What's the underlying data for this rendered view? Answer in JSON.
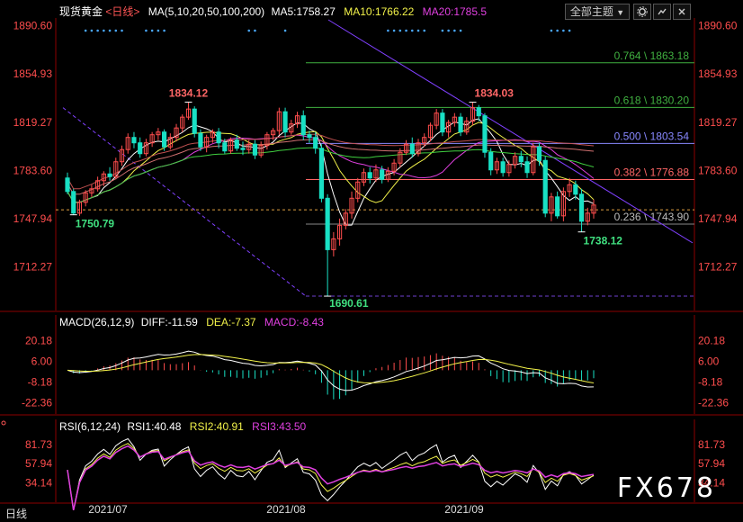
{
  "header": {
    "title": "现货黄金",
    "period": "<日线>",
    "ma_label": "MA(5,10,20,50,100,200)",
    "ma5": "MA5:1758.27",
    "ma10": "MA10:1766.22",
    "ma20": "MA20:1785.5",
    "menu_label": "全部主题",
    "menu_arrow": "▼"
  },
  "macd_header": {
    "label": "MACD(26,12,9)",
    "diff": "DIFF:-11.59",
    "dea": "DEA:-7.37",
    "macd": "MACD:-8.43"
  },
  "rsi_header": {
    "label": "RSI(6,12,24)",
    "rsi1": "RSI1:40.48",
    "rsi2": "RSI2:40.91",
    "rsi3": "RSI3:43.50"
  },
  "period_button": "日线",
  "watermark": "FX678",
  "colors": {
    "up": "#ff4d4d",
    "down": "#19e0c4",
    "ma5": "#ffffff",
    "ma10": "#f2f24a",
    "ma20": "#e040e0",
    "ma50": "#40d040",
    "ma100": "#d07070",
    "ma200": "#7070e0",
    "fib": "#40b040",
    "fib_half": "#8888ff",
    "fib_382": "#ff6666",
    "trend": "#8040ff"
  },
  "chart_data": {
    "type": "candlestick",
    "price_axis": {
      "ticks": [
        "1890.60",
        "1854.93",
        "1819.27",
        "1783.60",
        "1747.94",
        "1712.27"
      ],
      "range": [
        1680,
        1895
      ]
    },
    "macd_axis": {
      "ticks": [
        "20.18",
        "6.00",
        "-8.18",
        "-22.36"
      ]
    },
    "rsi_axis": {
      "ticks": [
        "81.73",
        "57.94",
        "34.14"
      ]
    },
    "dates": [
      "2021/07",
      "2021/08",
      "2021/09"
    ],
    "fibonacci": [
      {
        "label": "0.764 \\ 1863.18",
        "value": 1863.18
      },
      {
        "label": "0.618 \\ 1830.20",
        "value": 1830.2
      },
      {
        "label": "0.500 \\ 1803.54",
        "value": 1803.54
      },
      {
        "label": "0.382 \\ 1776.88",
        "value": 1776.88
      },
      {
        "label": "0.236 \\ 1743.90",
        "value": 1743.9
      }
    ],
    "annotations": [
      {
        "text": "1834.12",
        "value": 1834.12
      },
      {
        "text": "1834.03",
        "value": 1834.03
      },
      {
        "text": "1750.79",
        "value": 1750.79
      },
      {
        "text": "1738.12",
        "value": 1738.12
      },
      {
        "text": "1690.61",
        "value": 1690.61
      }
    ],
    "last_price": 1754.5,
    "candles": [
      [
        1778,
        1768,
        1782,
        1766
      ],
      [
        1768,
        1752,
        1770,
        1750.79
      ],
      [
        1752,
        1760,
        1762,
        1750
      ],
      [
        1760,
        1767,
        1769,
        1757
      ],
      [
        1767,
        1770,
        1773,
        1764
      ],
      [
        1770,
        1776,
        1779,
        1768
      ],
      [
        1776,
        1781,
        1783,
        1772
      ],
      [
        1781,
        1779,
        1786,
        1776
      ],
      [
        1779,
        1790,
        1793,
        1777
      ],
      [
        1790,
        1799,
        1802,
        1787
      ],
      [
        1799,
        1808,
        1811,
        1796
      ],
      [
        1808,
        1804,
        1812,
        1800
      ],
      [
        1804,
        1796,
        1808,
        1793
      ],
      [
        1796,
        1804,
        1807,
        1794
      ],
      [
        1804,
        1810,
        1812,
        1801
      ],
      [
        1810,
        1812,
        1815,
        1806
      ],
      [
        1812,
        1801,
        1814,
        1798
      ],
      [
        1801,
        1808,
        1811,
        1799
      ],
      [
        1808,
        1815,
        1818,
        1805
      ],
      [
        1815,
        1823,
        1825,
        1812
      ],
      [
        1823,
        1829,
        1834.12,
        1821
      ],
      [
        1829,
        1811,
        1831,
        1808
      ],
      [
        1811,
        1801,
        1814,
        1798
      ],
      [
        1801,
        1808,
        1810,
        1797
      ],
      [
        1808,
        1812,
        1814,
        1804
      ],
      [
        1812,
        1804,
        1815,
        1800
      ],
      [
        1804,
        1798,
        1807,
        1796
      ],
      [
        1798,
        1806,
        1808,
        1796
      ],
      [
        1806,
        1800,
        1810,
        1798
      ],
      [
        1800,
        1799,
        1805,
        1795
      ],
      [
        1799,
        1803,
        1806,
        1796
      ],
      [
        1803,
        1795,
        1806,
        1792
      ],
      [
        1795,
        1802,
        1805,
        1793
      ],
      [
        1802,
        1810,
        1812,
        1799
      ],
      [
        1810,
        1813,
        1815,
        1806
      ],
      [
        1813,
        1827,
        1830,
        1810
      ],
      [
        1827,
        1812,
        1830,
        1808
      ],
      [
        1812,
        1818,
        1821,
        1810
      ],
      [
        1818,
        1824,
        1827,
        1815
      ],
      [
        1824,
        1810,
        1828,
        1806
      ],
      [
        1810,
        1808,
        1813,
        1804
      ],
      [
        1808,
        1800,
        1812,
        1796
      ],
      [
        1800,
        1763,
        1803,
        1760
      ],
      [
        1763,
        1725,
        1766,
        1690.61
      ],
      [
        1725,
        1733,
        1738,
        1720
      ],
      [
        1733,
        1743,
        1748,
        1728
      ],
      [
        1743,
        1752,
        1755,
        1740
      ],
      [
        1752,
        1763,
        1768,
        1748
      ],
      [
        1763,
        1775,
        1778,
        1760
      ],
      [
        1775,
        1782,
        1785,
        1772
      ],
      [
        1782,
        1778,
        1786,
        1774
      ],
      [
        1778,
        1784,
        1788,
        1775
      ],
      [
        1784,
        1777,
        1787,
        1774
      ],
      [
        1777,
        1783,
        1786,
        1775
      ],
      [
        1783,
        1789,
        1792,
        1780
      ],
      [
        1789,
        1797,
        1800,
        1786
      ],
      [
        1797,
        1803,
        1806,
        1795
      ],
      [
        1803,
        1796,
        1808,
        1793
      ],
      [
        1796,
        1804,
        1807,
        1794
      ],
      [
        1804,
        1808,
        1811,
        1801
      ],
      [
        1808,
        1817,
        1819,
        1805
      ],
      [
        1817,
        1826,
        1829,
        1814
      ],
      [
        1826,
        1812,
        1829,
        1809
      ],
      [
        1812,
        1819,
        1821,
        1808
      ],
      [
        1819,
        1823,
        1826,
        1816
      ],
      [
        1823,
        1812,
        1826,
        1809
      ],
      [
        1812,
        1820,
        1823,
        1810
      ],
      [
        1820,
        1830,
        1834.03,
        1817
      ],
      [
        1830,
        1824,
        1832,
        1820
      ],
      [
        1824,
        1797,
        1826,
        1793
      ],
      [
        1797,
        1784,
        1800,
        1780
      ],
      [
        1784,
        1790,
        1793,
        1781
      ],
      [
        1790,
        1782,
        1793,
        1779
      ],
      [
        1782,
        1788,
        1791,
        1779
      ],
      [
        1788,
        1794,
        1797,
        1785
      ],
      [
        1794,
        1790,
        1798,
        1786
      ],
      [
        1790,
        1782,
        1794,
        1778
      ],
      [
        1782,
        1801,
        1804,
        1780
      ],
      [
        1801,
        1791,
        1804,
        1787
      ],
      [
        1791,
        1752,
        1794,
        1749
      ],
      [
        1752,
        1764,
        1767,
        1746
      ],
      [
        1764,
        1750,
        1768,
        1748
      ],
      [
        1750,
        1768,
        1771,
        1746
      ],
      [
        1768,
        1773,
        1778,
        1764
      ],
      [
        1773,
        1766,
        1776,
        1762
      ],
      [
        1766,
        1746,
        1770,
        1738.12
      ],
      [
        1746,
        1752,
        1756,
        1743
      ],
      [
        1752,
        1758,
        1762,
        1748
      ]
    ]
  }
}
